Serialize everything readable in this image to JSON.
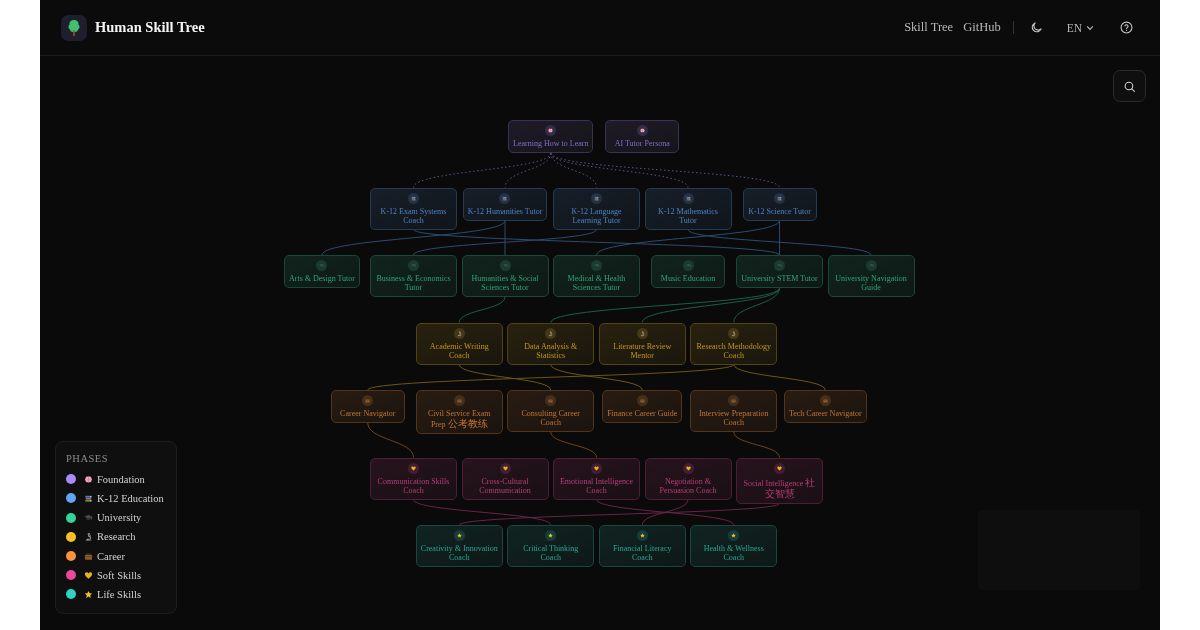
{
  "header": {
    "title": "Human Skill Tree",
    "nav_links": [
      "Skill Tree",
      "GitHub"
    ],
    "language": "EN"
  },
  "tree": {
    "rows": [
      {
        "kind": "foundation",
        "nodes": [
          {
            "label": "Learning How to Learn"
          },
          {
            "label": "AI Tutor Persona"
          }
        ]
      },
      {
        "kind": "k12",
        "nodes": [
          {
            "label": "K-12 Exam Systems Coach"
          },
          {
            "label": "K-12 Humanities Tutor"
          },
          {
            "label": "K-12 Language Learning Tutor"
          },
          {
            "label": "K-12 Mathematics Tutor"
          },
          {
            "label": "K-12 Science Tutor"
          }
        ]
      },
      {
        "kind": "university",
        "nodes": [
          {
            "label": "Arts & Design Tutor"
          },
          {
            "label": "Business & Economics Tutor"
          },
          {
            "label": "Humanities & Social Sciences Tutor"
          },
          {
            "label": "Medical & Health Sciences Tutor"
          },
          {
            "label": "Music Education"
          },
          {
            "label": "University STEM Tutor"
          },
          {
            "label": "University Navigation Guide"
          }
        ]
      },
      {
        "kind": "research",
        "nodes": [
          {
            "label": "Academic Writing Coach"
          },
          {
            "label": "Data Analysis & Statistics"
          },
          {
            "label": "Literature Review Mentor"
          },
          {
            "label": "Research Methodology Coach"
          }
        ]
      },
      {
        "kind": "career",
        "nodes": [
          {
            "label": "Career Navigator"
          },
          {
            "label": "Civil Service Exam Prep",
            "label_zh": "公考教练"
          },
          {
            "label": "Consulting Career Coach"
          },
          {
            "label": "Finance Career Guide"
          },
          {
            "label": "Interview Preparation Coach"
          },
          {
            "label": "Tech Career Navigator"
          }
        ]
      },
      {
        "kind": "soft_skills",
        "nodes": [
          {
            "label": "Communication Skills Coach"
          },
          {
            "label": "Cross-Cultural Communication"
          },
          {
            "label": "Emotional Intelligence Coach"
          },
          {
            "label": "Negotiation & Persuasion Coach"
          },
          {
            "label": "Social Intelligence",
            "label_zh": "社交智慧"
          }
        ]
      },
      {
        "kind": "life_skills",
        "nodes": [
          {
            "label": "Creativity & Innovation Coach"
          },
          {
            "label": "Critical Thinking Coach"
          },
          {
            "label": "Financial Literacy Coach"
          },
          {
            "label": "Health & Wellness Coach"
          }
        ]
      }
    ]
  },
  "legend": {
    "title": "PHASES",
    "items": [
      {
        "name": "Foundation",
        "kind": "foundation",
        "color": "#a78bfa"
      },
      {
        "name": "K-12 Education",
        "kind": "k12",
        "color": "#60a5fa"
      },
      {
        "name": "University",
        "kind": "university",
        "color": "#34d399"
      },
      {
        "name": "Research",
        "kind": "research",
        "color": "#fbbf24"
      },
      {
        "name": "Career",
        "kind": "career",
        "color": "#fb923c"
      },
      {
        "name": "Soft Skills",
        "kind": "soft_skills",
        "color": "#ec4899"
      },
      {
        "name": "Life Skills",
        "kind": "life_skills",
        "color": "#2dd4bf"
      }
    ]
  }
}
